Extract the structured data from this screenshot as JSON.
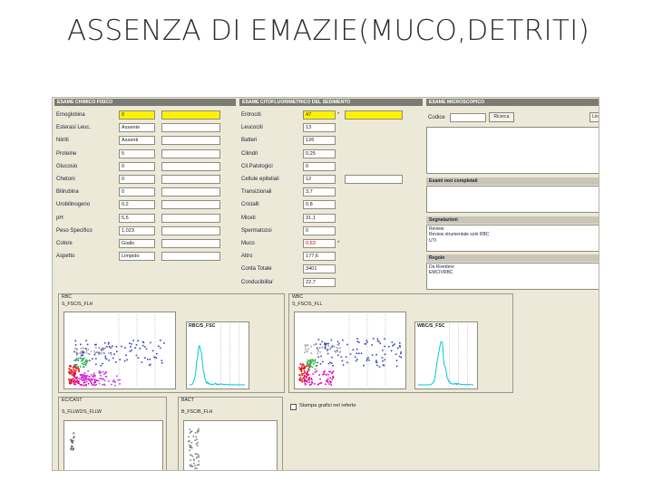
{
  "slide_title": "ASSENZA DI EMAZIE(MUCO,DETRITI)",
  "colors": {
    "header_bg": "#7b7b73",
    "panel_bg": "#ece9d8",
    "highlight": "#fff200",
    "alert": "#d40000"
  },
  "chimico": {
    "header": "ESAME CHIMICO FISICO",
    "rows": [
      {
        "label": "Emoglobina",
        "value": "0",
        "highlight": true
      },
      {
        "label": "Esterasi Leuc.",
        "value": "Assente"
      },
      {
        "label": "Nitriti",
        "value": "Assenti"
      },
      {
        "label": "Proteine",
        "value": "5"
      },
      {
        "label": "Glucosio",
        "value": "0"
      },
      {
        "label": "Chetoni",
        "value": "0"
      },
      {
        "label": "Bilirubina",
        "value": "0"
      },
      {
        "label": "Urobilinogeno",
        "value": "0,2"
      },
      {
        "label": "pH",
        "value": "5,5"
      },
      {
        "label": "Peso Specifico",
        "value": "1,023"
      },
      {
        "label": "Colore",
        "value": "Giallo"
      },
      {
        "label": "Aspetto",
        "value": "Limpido"
      }
    ]
  },
  "citofluoro": {
    "header": "ESAME CITOFLUORIMETRICO DEL SEDIMENTO",
    "rows": [
      {
        "label": "Eritrociti",
        "value": "47",
        "highlight": true,
        "star": "*"
      },
      {
        "label": "Leucociti",
        "value": "13"
      },
      {
        "label": "Batteri",
        "value": "126"
      },
      {
        "label": "Cilindri",
        "value": "0,25"
      },
      {
        "label": "Cil.Patologici",
        "value": "0"
      },
      {
        "label": "Cellule epiteliali",
        "value": "12"
      },
      {
        "label": "Transizionali",
        "value": "3,7"
      },
      {
        "label": "Cristalli",
        "value": "0,8"
      },
      {
        "label": "Miceti",
        "value": "31,1"
      },
      {
        "label": "Spermatozoi",
        "value": "0"
      },
      {
        "label": "Muco",
        "value": "0,63",
        "red": true,
        "star": "*"
      },
      {
        "label": "Altro",
        "value": "177,6"
      },
      {
        "label": "Conta Totale",
        "value": "3401"
      },
      {
        "label": "Conducibilita'",
        "value": "22,7"
      }
    ]
  },
  "microscopico": {
    "header": "ESAME MICROSCOPICO",
    "codice_label": "Codice",
    "button_label": "Ricerca",
    "cut_button": "Lin"
  },
  "non_completati": {
    "header": "Esami non completati"
  },
  "segnalazioni": {
    "header": "Segnalazioni",
    "lines": [
      "Review",
      "Review strumentale solo RBC",
      "UTI"
    ]
  },
  "regole": {
    "header": "Regole",
    "lines": [
      "Da Rivedere",
      "EMCIVRBC"
    ]
  },
  "graphs": {
    "rbc": {
      "title": "RBC",
      "scatter_label": "S_FSC/S_FLH",
      "hist_label": "RBC/S_FSC"
    },
    "wbc": {
      "title": "WBC",
      "scatter_label": "S_FSC/S_FLL",
      "hist_label": "WBC/S_FSC"
    },
    "ec_cast": {
      "title": "EC/CAST",
      "scatter_label": "S_FLLW2/S_FLLW"
    },
    "bact": {
      "title": "BACT",
      "scatter_label": "B_FSC/B_FLH"
    },
    "print_option": "Stampa grafici nel referto"
  }
}
